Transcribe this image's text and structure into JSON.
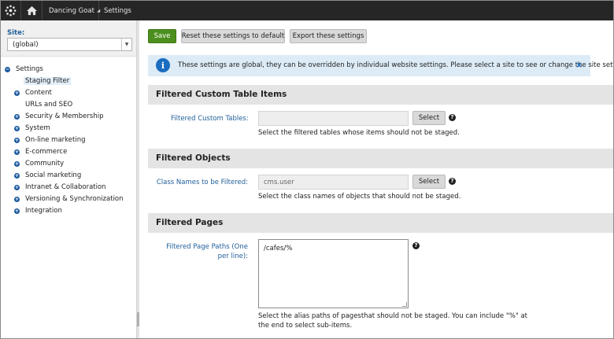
{
  "topbar": {
    "logo_icon": "kentico-logo-icon",
    "home_icon": "home-icon",
    "site_name": "Dancing Goat",
    "app_name": "Settings"
  },
  "sidebar": {
    "site_label": "Site:",
    "site_value": "(global)",
    "tree": [
      {
        "label": "Settings",
        "expandable": true,
        "expanded": true,
        "level": 0
      },
      {
        "label": "Staging Filter",
        "expandable": false,
        "level": 1,
        "selected": true
      },
      {
        "label": "Content",
        "expandable": true,
        "level": 1
      },
      {
        "label": "URLs and SEO",
        "expandable": false,
        "level": 1
      },
      {
        "label": "Security & Membership",
        "expandable": true,
        "level": 1
      },
      {
        "label": "System",
        "expandable": true,
        "level": 1
      },
      {
        "label": "On-line marketing",
        "expandable": true,
        "level": 1
      },
      {
        "label": "E-commerce",
        "expandable": true,
        "level": 1
      },
      {
        "label": "Community",
        "expandable": true,
        "level": 1
      },
      {
        "label": "Social marketing",
        "expandable": true,
        "level": 1
      },
      {
        "label": "Intranet & Collaboration",
        "expandable": true,
        "level": 1
      },
      {
        "label": "Versioning & Synchronization",
        "expandable": true,
        "level": 1
      },
      {
        "label": "Integration",
        "expandable": true,
        "level": 1
      }
    ]
  },
  "toolbar": {
    "save_label": "Save",
    "reset_label": "Reset these settings to default",
    "export_label": "Export these settings"
  },
  "info": {
    "message": "These settings are global, they can be overridden by individual website settings. Please select a site to see or change the site settings.",
    "close": "×"
  },
  "sections": {
    "custom_tables": {
      "title": "Filtered Custom Table Items",
      "field_label": "Filtered Custom Tables:",
      "value": "",
      "button": "Select",
      "help": "?",
      "hint": "Select the filtered tables whose items should not be staged."
    },
    "objects": {
      "title": "Filtered Objects",
      "field_label": "Class Names to be Filtered:",
      "value": "cms.user",
      "button": "Select",
      "help": "?",
      "hint": "Select the class names of objects that should not be staged."
    },
    "pages": {
      "title": "Filtered Pages",
      "field_label": "Filtered Page Paths (One per line):",
      "value": "/cafes/%",
      "help": "?",
      "hint": "Select the alias paths of pagesthat should not be staged. You can include \"%\" at the end to select sub-items."
    }
  },
  "colors": {
    "topbar_bg": "#262626",
    "save_green": "#4c8f1e",
    "label_blue": "#1f5e99",
    "info_bg": "#dcebf6",
    "info_icon": "#1a6dbf",
    "section_bg": "#e4e4e4"
  }
}
